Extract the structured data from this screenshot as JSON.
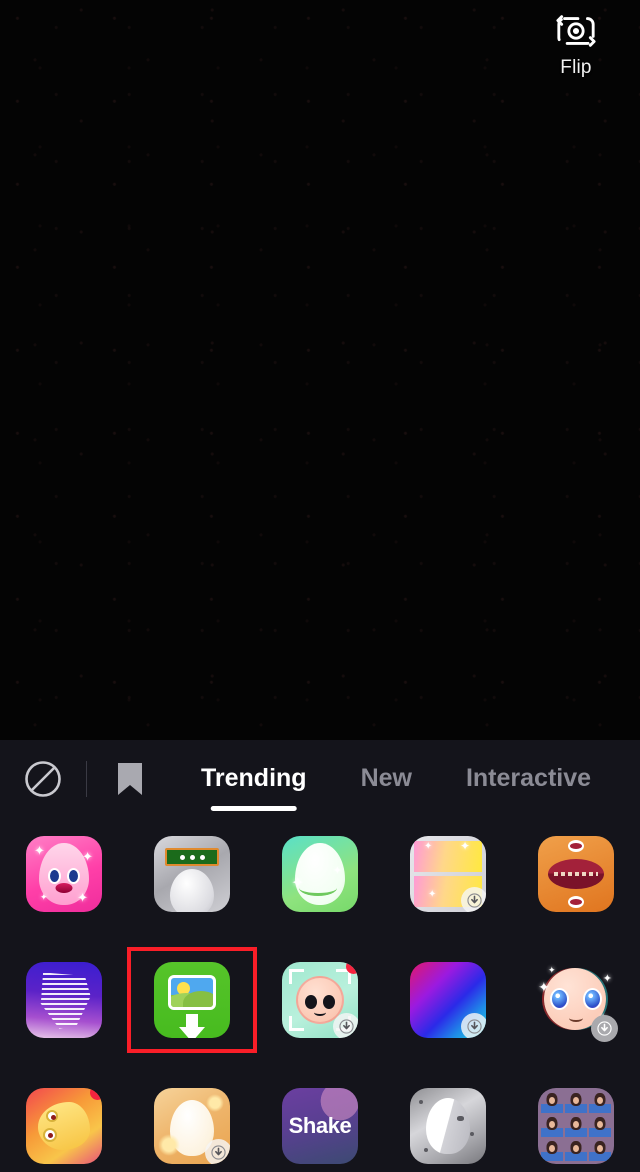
{
  "screen": {
    "app": "camera-effects-picker",
    "background_color": "#000000",
    "panel_color": "#14141b"
  },
  "preview": {
    "label": "camera-preview",
    "state": "black"
  },
  "top_controls": {
    "flip": {
      "label": "Flip",
      "icon": "flip-camera-icon"
    }
  },
  "effects_panel": {
    "left_controls": [
      {
        "name": "no-effect",
        "icon": "circle-slash-icon"
      },
      {
        "name": "saved-effects",
        "icon": "bookmark-icon"
      }
    ],
    "tabs": [
      {
        "label": "Trending",
        "active": true
      },
      {
        "label": "New",
        "active": false
      },
      {
        "label": "Interactive",
        "active": false
      }
    ],
    "selected_index": 6,
    "selection_color": "#fa1e28",
    "effects": [
      {
        "name": "doll-face-effect",
        "art": "t-doll",
        "shape": "rounded",
        "download": false,
        "badge_solid": false,
        "new": false
      },
      {
        "name": "meter-head-effect",
        "art": "t-meter",
        "shape": "rounded",
        "download": false,
        "badge_solid": false,
        "new": false
      },
      {
        "name": "green-smile-effect",
        "art": "t-green",
        "shape": "rounded",
        "download": false,
        "badge_solid": false,
        "new": false
      },
      {
        "name": "split-screen-effect",
        "art": "t-split",
        "shape": "rounded",
        "download": true,
        "badge_solid": false,
        "new": false
      },
      {
        "name": "lips-teeth-effect",
        "art": "t-lips",
        "shape": "rounded",
        "download": false,
        "badge_solid": false,
        "new": false
      },
      {
        "name": "glitch-lines-effect",
        "art": "t-glitch",
        "shape": "rounded",
        "download": false,
        "badge_solid": false,
        "new": false
      },
      {
        "name": "upload-photo-effect",
        "art": "t-upload",
        "shape": "rounded",
        "download": false,
        "badge_solid": false,
        "new": false
      },
      {
        "name": "face-scan-baby-effect",
        "art": "t-scan",
        "shape": "rounded",
        "download": true,
        "badge_solid": false,
        "new": true
      },
      {
        "name": "aurora-gradient-effect",
        "art": "t-aurora",
        "shape": "rounded",
        "download": true,
        "badge_solid": false,
        "new": false
      },
      {
        "name": "big-eyes-effect",
        "art": "t-bigeyes",
        "shape": "circle",
        "download": true,
        "badge_solid": true,
        "new": false
      },
      {
        "name": "bird-face-effect",
        "art": "t-bird",
        "shape": "rounded",
        "download": false,
        "badge_solid": false,
        "new": true
      },
      {
        "name": "glow-egg-effect",
        "art": "t-egg",
        "shape": "rounded",
        "download": true,
        "badge_solid": false,
        "new": false
      },
      {
        "name": "shake-effect",
        "art": "t-shake",
        "shape": "rounded",
        "download": false,
        "badge_solid": false,
        "new": false,
        "text": "Shake"
      },
      {
        "name": "gray-face-effect",
        "art": "t-gray",
        "shape": "rounded",
        "download": false,
        "badge_solid": false,
        "new": false
      },
      {
        "name": "nine-grid-effect",
        "art": "t-grid9",
        "shape": "rounded",
        "download": false,
        "badge_solid": false,
        "new": false
      }
    ]
  }
}
